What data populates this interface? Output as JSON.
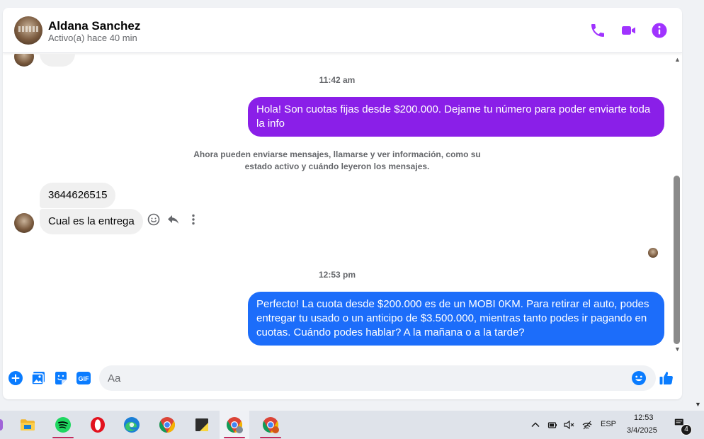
{
  "header": {
    "contact_name": "Aldana Sanchez",
    "status": "Activo(a) hace 40 min"
  },
  "colors": {
    "accent": "#a033ff",
    "bubble_purple": "#8a1fe8",
    "bubble_blue": "#1c6dfa",
    "action_blue": "#0a7cff"
  },
  "messages": {
    "time_1": "11:42 am",
    "out_1": "Hola! Son cuotas fijas desde $200.000. Dejame tu número para poder enviarte toda la info",
    "system_note": "Ahora pueden enviarse mensajes, llamarse y ver información, como su estado activo y cuándo leyeron los mensajes.",
    "in_1": "3644626515",
    "in_2": "Cual es la entrega",
    "time_2": "12:53 pm",
    "out_2": "Perfecto! La cuota desde $200.000 es de un MOBI 0KM. Para retirar el auto, podes entregar tu usado o un anticipo de $3.500.000, mientras tanto podes ir pagando en cuotas. Cuándo podes hablar? A la mañana o a la tarde?"
  },
  "composer": {
    "placeholder": "Aa"
  },
  "taskbar": {
    "apps": [
      "file-explorer",
      "spotify",
      "opera",
      "edge",
      "chrome",
      "sticky-notes",
      "chrome-profile-y",
      "chrome-profile-r"
    ],
    "language": "ESP",
    "time": "12:53",
    "date": "3/4/2025",
    "notification_count": "4"
  }
}
